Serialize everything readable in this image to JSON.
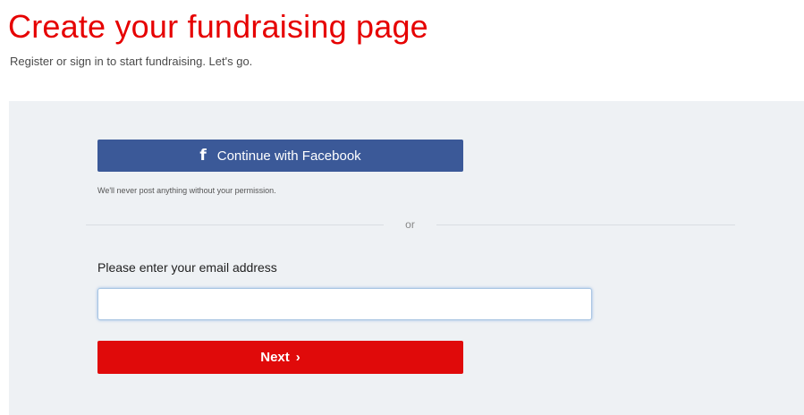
{
  "header": {
    "title": "Create your fundraising page",
    "subtitle": "Register or sign in to start fundraising. Let's go."
  },
  "form": {
    "facebook_button": {
      "icon": "facebook-icon",
      "label": "Continue with Facebook",
      "color": "#3b5998"
    },
    "facebook_note": "We'll never post anything without your permission.",
    "divider_text": "or",
    "email_label": "Please enter your email address",
    "email_value": "",
    "email_placeholder": "",
    "next_button": {
      "label": "Next",
      "icon": "chevron-right-icon",
      "color": "#e00a0a"
    }
  },
  "colors": {
    "accent": "#e60000",
    "panel_background": "#eef1f4"
  }
}
